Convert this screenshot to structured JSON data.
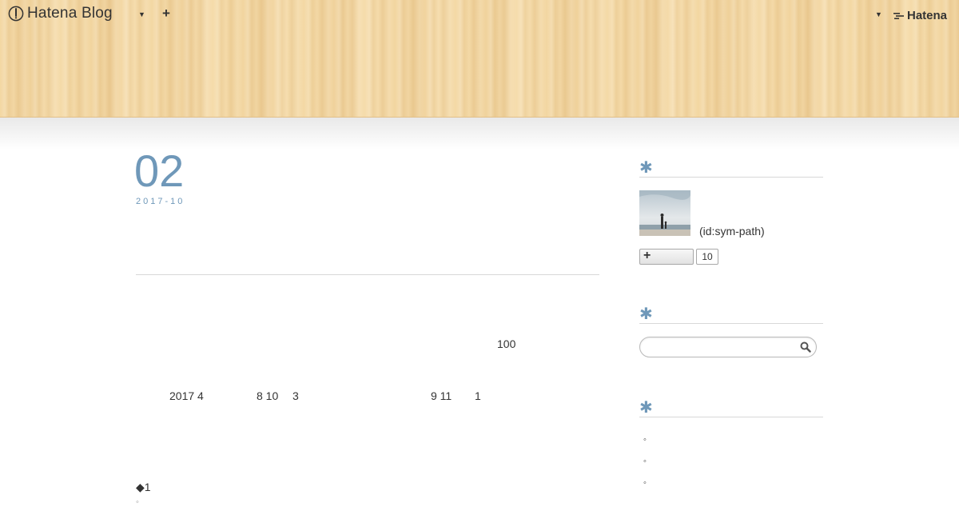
{
  "globalbar": {
    "brand": "Hatena Blog",
    "add_label": "+",
    "hatena_label": "Hatena"
  },
  "entry": {
    "day": "02",
    "year_month": "2017-10",
    "lines": [
      {
        "id": "n100",
        "text": "100"
      },
      {
        "id": "l1a",
        "text": "2017 4"
      },
      {
        "id": "l1b",
        "text": "8 10"
      },
      {
        "id": "l1c",
        "text": "3"
      },
      {
        "id": "l1d",
        "text": "9 11"
      },
      {
        "id": "l1e",
        "text": "1"
      },
      {
        "id": "item1",
        "text": "◆1"
      }
    ]
  },
  "sidebar": {
    "profile_heading": "",
    "profile_id": "(id:sym-path)",
    "follow_plus": "+",
    "follower_count": "10",
    "search_placeholder": "",
    "list_bullets": [
      "◦",
      "◦",
      "◦"
    ]
  },
  "colors": {
    "accent": "#6f98b9",
    "wood": "#f3d7a2"
  }
}
